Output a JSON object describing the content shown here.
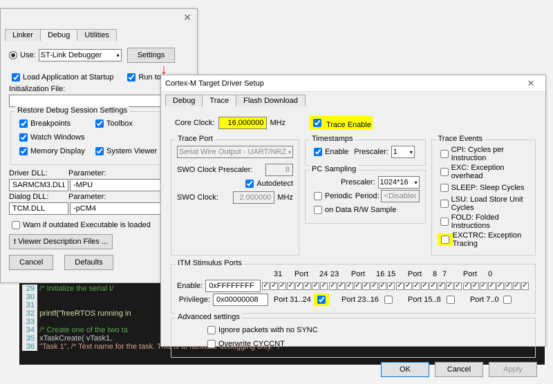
{
  "back_dialog": {
    "top_tabs": {
      "linker": "Linker",
      "debug": "Debug",
      "utilities": "Utilities"
    },
    "use_label": "Use:",
    "debugger_sel": "ST-Link Debugger",
    "settings_btn": "Settings",
    "load_app": "Load Application at Startup",
    "run_to": "Run to",
    "init_file": "Initialization File:",
    "restore_legend": "Restore Debug Session Settings",
    "breakpoints": "Breakpoints",
    "toolbox": "Toolbox",
    "watch_windows": "Watch Windows",
    "memory_display": "Memory Display",
    "system_viewer": "System Viewer",
    "driver_dll_lbl": "Driver DLL:",
    "parameter_lbl": "Parameter:",
    "driver_dll_val": "SARMCM3.DLL",
    "driver_param_val": "-MPU",
    "dialog_dll_lbl": "Dialog DLL:",
    "dialog_dll_val": "TCM.DLL",
    "dialog_param_val": "-pCM4",
    "warn_exec": "Warn if outdated Executable is loaded",
    "viewer_files_btn": "t Viewer Description Files ...",
    "cancel_btn": "Cancel",
    "defaults_btn": "Defaults"
  },
  "main_dialog": {
    "title": "Cortex-M Target Driver Setup",
    "close": "✕",
    "tabs": {
      "debug": "Debug",
      "trace": "Trace",
      "flash": "Flash Download"
    },
    "core_clock_lbl": "Core Clock:",
    "core_clock_val": "16.000000",
    "mhz": "MHz",
    "trace_enable": "Trace Enable",
    "trace_port_legend": "Trace Port",
    "trace_port_sel": "Serial Wire Output - UART/NRZ",
    "swo_prescaler_lbl": "SWO Clock Prescaler:",
    "swo_prescaler_val": "8",
    "autodetect": "Autodetect",
    "swo_clock_lbl": "SWO Clock:",
    "swo_clock_val": "2.000000",
    "timestamps_legend": "Timestamps",
    "enable": "Enable",
    "prescaler_lbl": "Prescaler:",
    "ts_prescaler_val": "1",
    "pc_sampling_legend": "PC Sampling",
    "pc_prescaler_val": "1024*16",
    "periodic": "Periodic",
    "period_lbl": "Period:",
    "period_val": "<Disabled>",
    "on_data_rw": "on Data R/W Sample",
    "trace_events_legend": "Trace Events",
    "ev_cpi": "CPI: Cycles per Instruction",
    "ev_exc": "EXC: Exception overhead",
    "ev_sleep": "SLEEP: Sleep Cycles",
    "ev_lsu": "LSU: Load Store Unit Cycles",
    "ev_fold": "FOLD: Folded Instructions",
    "ev_exctrc": "EXCTRC: Exception Tracing",
    "itm_legend": "ITM Stimulus Ports",
    "itm_enable_lbl": "Enable:",
    "itm_enable_val": "0xFFFFFFFF",
    "itm_priv_lbl": "Privilege:",
    "itm_priv_val": "0x00000008",
    "port_hdr_31": "31",
    "port_hdr_port": "Port",
    "port_hdr_24": "24",
    "port_hdr_23": "23",
    "port_hdr_16": "16",
    "port_hdr_15": "15",
    "port_hdr_8": "8",
    "port_hdr_7": "7",
    "port_hdr_0": "0",
    "port_31_24": "Port 31..24",
    "port_23_16": "Port 23..16",
    "port_15_8": "Port 15..8",
    "port_7_0": "Port 7..0",
    "advanced_legend": "Advanced settings",
    "ignore_sync": "Ignore packets with no SYNC",
    "overwrite_cyccnt": "Overwrite CYCCNT",
    "ok_btn": "OK",
    "cancel_btn": "Cancel",
    "apply_btn": "Apply"
  },
  "code": {
    "l29": "/* Initialize the serial I/",
    "l32": "printf(\"freeRTOS running in",
    "l34": "/* Create one of the two ta",
    "l35_a": "xTaskCreate(  vTask1,",
    "l36_a": "\"Task 1\", /* Text name for the task.  This is to facilitate debugging only. */"
  }
}
